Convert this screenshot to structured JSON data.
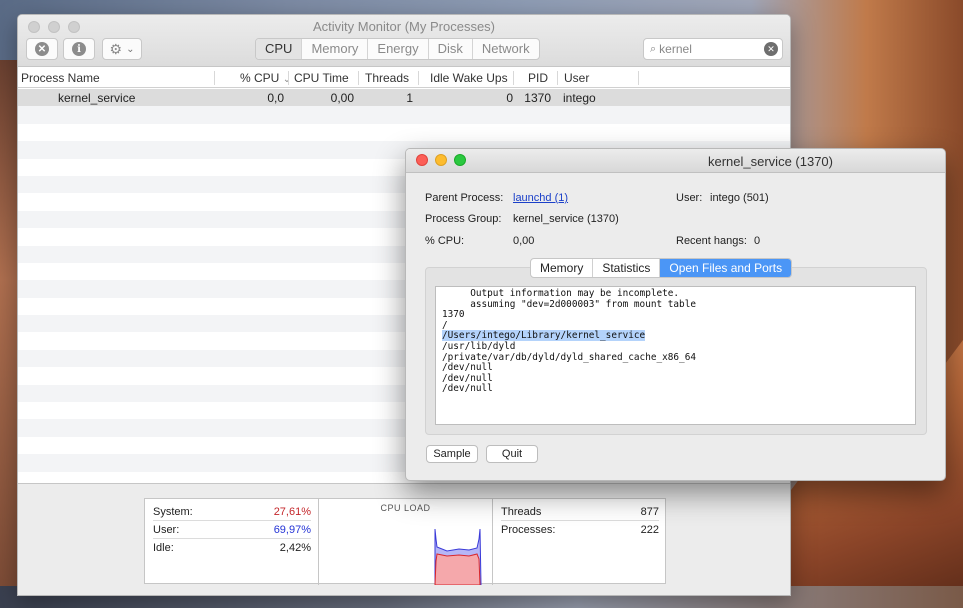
{
  "main_window": {
    "title": "Activity Monitor (My Processes)",
    "toolbar": {
      "stop_icon": "x-circle-icon",
      "info_icon": "info-icon",
      "gear_icon": "gear-icon",
      "gear_chevron": "⌄",
      "tabs": [
        "CPU",
        "Memory",
        "Energy",
        "Disk",
        "Network"
      ],
      "active_tab": "CPU",
      "search_value": "kernel"
    },
    "columns": [
      "Process Name",
      "% CPU",
      "CPU Time",
      "Threads",
      "Idle Wake Ups",
      "PID",
      "User"
    ],
    "sort_indicator": "⌄",
    "rows": [
      {
        "name": "kernel_service",
        "cpu": "0,0",
        "cpu_time": "0,00",
        "threads": "1",
        "idle_wake_ups": "0",
        "pid": "1370",
        "user": "intego"
      }
    ]
  },
  "cpu_summary": {
    "system_label": "System:",
    "system_value": "27,61%",
    "user_label": "User:",
    "user_value": "69,97%",
    "idle_label": "Idle:",
    "idle_value": "2,42%",
    "cpu_load_title": "CPU LOAD",
    "threads_label": "Threads",
    "threads_value": "877",
    "processes_label": "Processes:",
    "processes_value": "222",
    "colors": {
      "system": "#c4272b",
      "user": "#2534d6"
    }
  },
  "inspector": {
    "title": "kernel_service (1370)",
    "parent_process_label": "Parent Process:",
    "parent_process_value": "launchd (1)",
    "user_label": "User:",
    "user_value": "intego (501)",
    "process_group_label": "Process Group:",
    "process_group_value": "kernel_service (1370)",
    "cpu_label": "% CPU:",
    "cpu_value": "0,00",
    "recent_hangs_label": "Recent hangs:",
    "recent_hangs_value": "0",
    "tabs": [
      "Memory",
      "Statistics",
      "Open Files and Ports"
    ],
    "active_tab": "Open Files and Ports",
    "output_lines": [
      "     Output information may be incomplete.",
      "     assuming \"dev=2d000003\" from mount table",
      "1370",
      "/",
      "/Users/intego/Library/kernel_service",
      "/usr/lib/dyld",
      "/private/var/db/dyld/dyld_shared_cache_x86_64",
      "/dev/null",
      "/dev/null",
      "/dev/null"
    ],
    "highlighted_line": 4,
    "sample_button": "Sample",
    "quit_button": "Quit",
    "traffic_light_colors": {
      "close": "#fc5f57",
      "minimize": "#fdbc2e",
      "zoom": "#2bc840"
    }
  }
}
